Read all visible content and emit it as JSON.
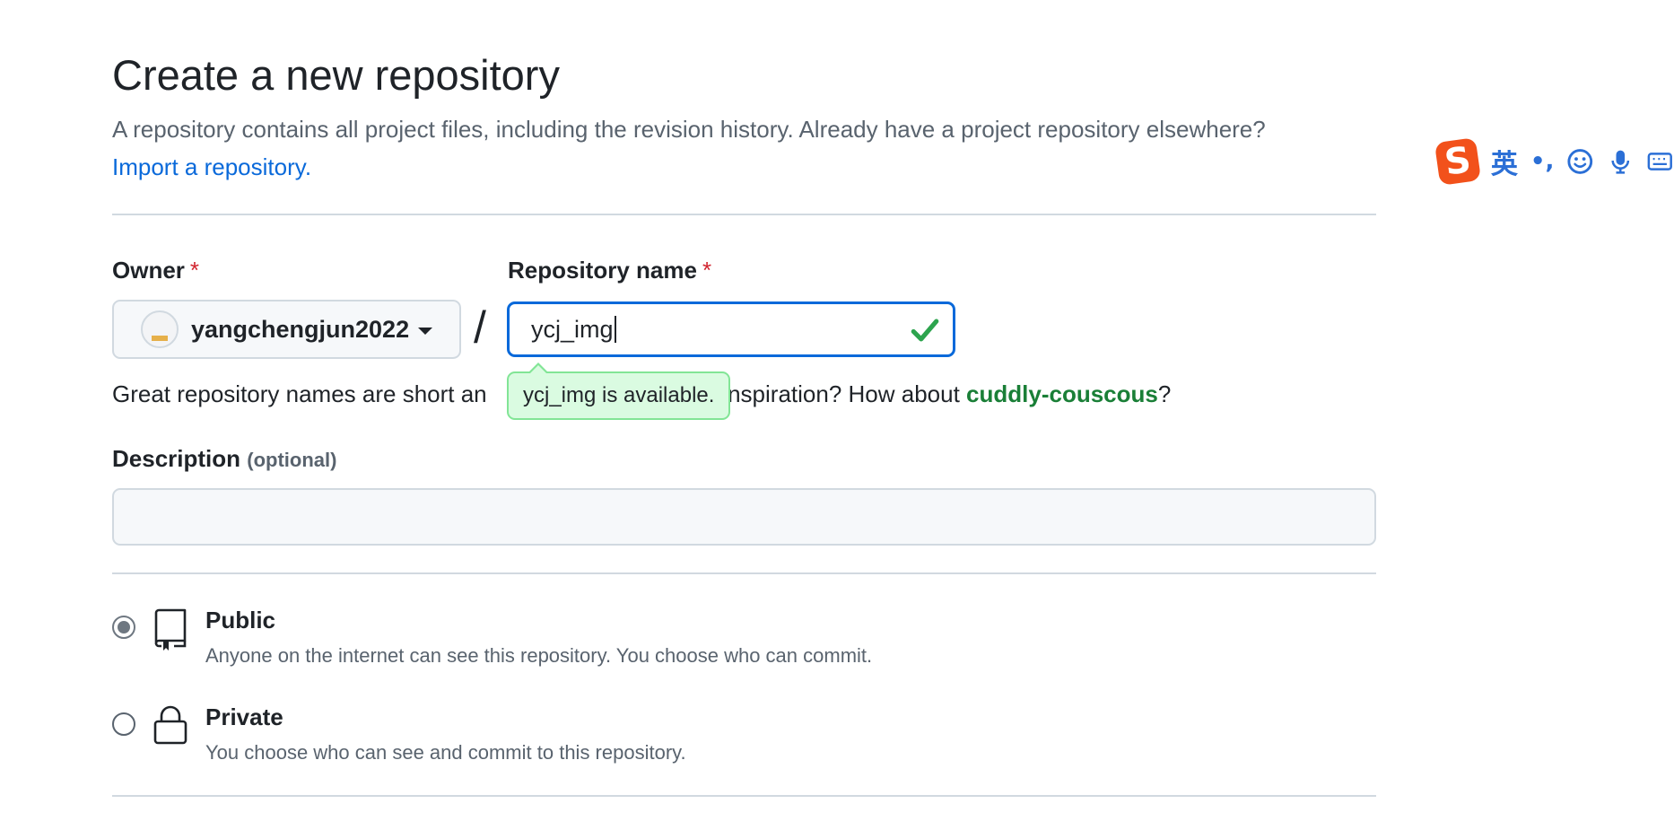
{
  "header": {
    "title": "Create a new repository",
    "description": "A repository contains all project files, including the revision history. Already have a project repository elsewhere?",
    "import_link": "Import a repository."
  },
  "owner": {
    "label": "Owner",
    "required_mark": "*",
    "value": "yangchengjun2022"
  },
  "repo_name": {
    "label": "Repository name",
    "required_mark": "*",
    "value": "ycj_img",
    "status": "valid"
  },
  "helper": {
    "text_before": "Great repository names are short an",
    "text_middle": "d inspiration? How about ",
    "suggestion": "cuddly-couscous",
    "text_after": "?"
  },
  "tooltip": {
    "text": "ycj_img is available."
  },
  "description_field": {
    "label": "Description",
    "optional": "(optional)",
    "value": ""
  },
  "visibility": {
    "options": [
      {
        "title": "Public",
        "description": "Anyone on the internet can see this repository. You choose who can commit.",
        "selected": true,
        "icon": "repo-icon"
      },
      {
        "title": "Private",
        "description": "You choose who can see and commit to this repository.",
        "selected": false,
        "icon": "lock-icon"
      }
    ]
  },
  "ime_toolbar": {
    "logo": "S",
    "mode": "英",
    "punct": "•,"
  },
  "colors": {
    "accent": "#0969da",
    "success": "#1a7f37",
    "required": "#d1242f",
    "tooltip_bg": "#dafbe1"
  }
}
